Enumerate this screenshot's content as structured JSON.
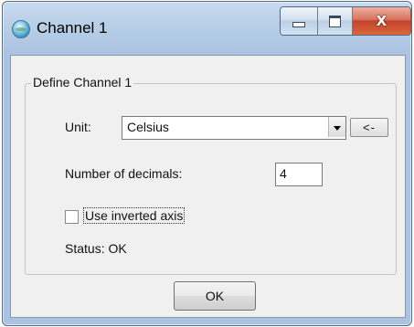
{
  "window": {
    "title": "Channel 1",
    "icon": "globe-icon",
    "caption_buttons": {
      "minimize_icon": "minimize-icon",
      "maximize_icon": "maximize-icon",
      "close_label": "X"
    }
  },
  "group": {
    "title": "Define Channel 1"
  },
  "unit": {
    "label": "Unit:",
    "value": "Celsius",
    "dropdown_icon": "chevron-down-icon",
    "side_button_label": "<-"
  },
  "decimals": {
    "label": "Number of decimals:",
    "value": "4"
  },
  "inverted_axis": {
    "label": "Use inverted axis",
    "checked": false
  },
  "status": {
    "text": "Status: OK"
  },
  "actions": {
    "ok_label": "OK"
  },
  "colors": {
    "titlebar": "#b9cfe7",
    "close_button": "#c9482f",
    "client_background": "#f0f0f0"
  }
}
